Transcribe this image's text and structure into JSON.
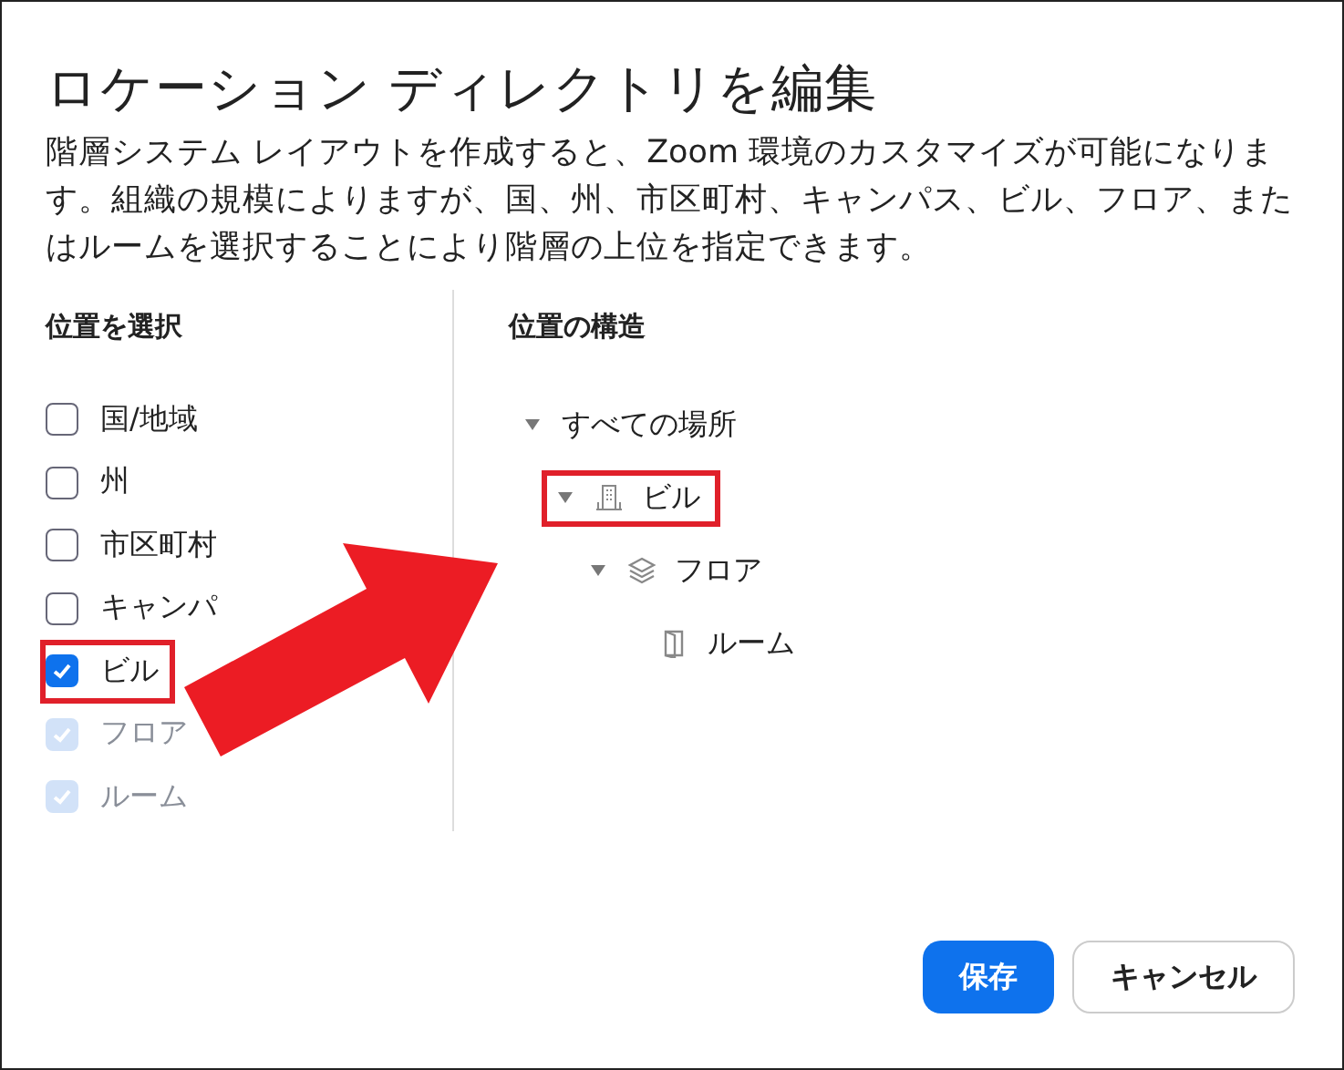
{
  "dialog": {
    "title": "ロケーション ディレクトリを編集",
    "description": "階層システム レイアウトを作成すると、Zoom 環境のカスタマイズが可能になります。組織の規模によりますが、国、州、市区町村、キャンパス、ビル、フロア、またはルームを選択することにより階層の上位を指定できます。"
  },
  "select_panel": {
    "heading": "位置を選択",
    "items": [
      {
        "label": "国/地域",
        "checked": false,
        "disabled": false,
        "highlighted": false
      },
      {
        "label": "州",
        "checked": false,
        "disabled": false,
        "highlighted": false
      },
      {
        "label": "市区町村",
        "checked": false,
        "disabled": false,
        "highlighted": false
      },
      {
        "label": "キャンパ",
        "checked": false,
        "disabled": false,
        "highlighted": false
      },
      {
        "label": "ビル",
        "checked": true,
        "disabled": false,
        "highlighted": true
      },
      {
        "label": "フロア",
        "checked": true,
        "disabled": true,
        "highlighted": false
      },
      {
        "label": "ルーム",
        "checked": true,
        "disabled": true,
        "highlighted": false
      }
    ]
  },
  "structure_panel": {
    "heading": "位置の構造",
    "tree": [
      {
        "label": "すべての場所",
        "expanded": true,
        "highlighted": false,
        "children": [
          {
            "label": "ビル",
            "kind": "building",
            "expanded": true,
            "highlighted": true,
            "children": [
              {
                "label": "フロア",
                "kind": "floor",
                "expanded": true,
                "highlighted": false,
                "children": [
                  {
                    "label": "ルーム",
                    "kind": "room",
                    "highlighted": false
                  }
                ]
              }
            ]
          }
        ]
      }
    ]
  },
  "buttons": [
    {
      "label": "保存",
      "kind": "primary"
    },
    {
      "label": "キャンセル",
      "kind": "secondary"
    }
  ]
}
